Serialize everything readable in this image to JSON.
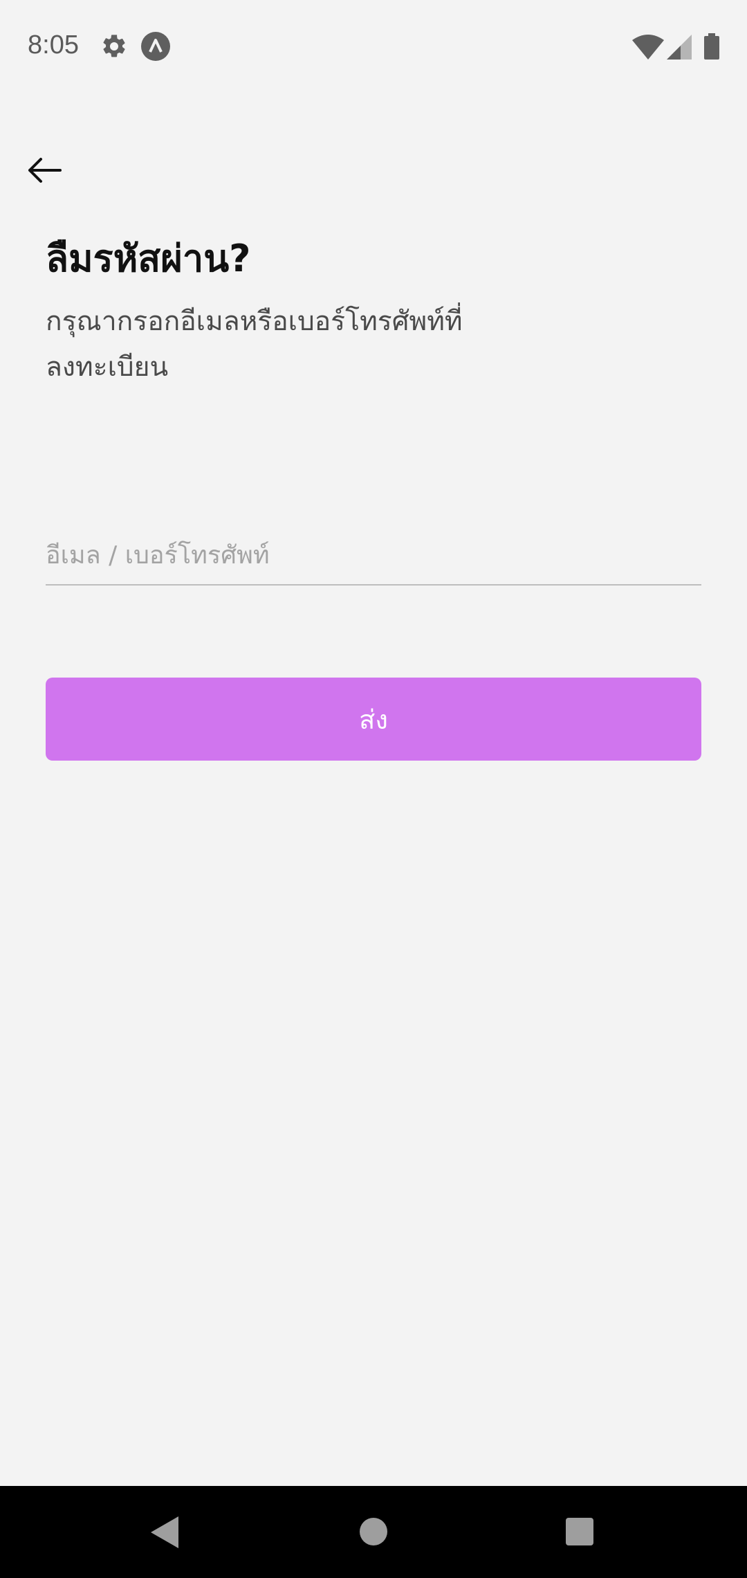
{
  "status_bar": {
    "time": "8:05",
    "icons": [
      "gear-icon",
      "app-a-icon",
      "wifi-icon",
      "cell-signal-icon",
      "battery-icon"
    ]
  },
  "header": {
    "back_icon": "arrow-left-icon"
  },
  "main": {
    "title": "ลืมรหัสผ่าน?",
    "subtitle_line1": "กรุณากรอกอีเมลหรือเบอร์โทรศัพท์ที่",
    "subtitle_line2": "ลงทะเบียน",
    "input": {
      "placeholder": "อีเมล / เบอร์โทรศัพท์",
      "value": ""
    },
    "submit_label": "ส่ง"
  },
  "nav_bar": {
    "icons": [
      "nav-back-icon",
      "nav-home-icon",
      "nav-recents-icon"
    ]
  },
  "colors": {
    "background": "#f3f3f3",
    "accent": "#d075ee",
    "title": "#111111",
    "subtitle": "#4a4a4a",
    "placeholder": "#a3a3a3"
  }
}
